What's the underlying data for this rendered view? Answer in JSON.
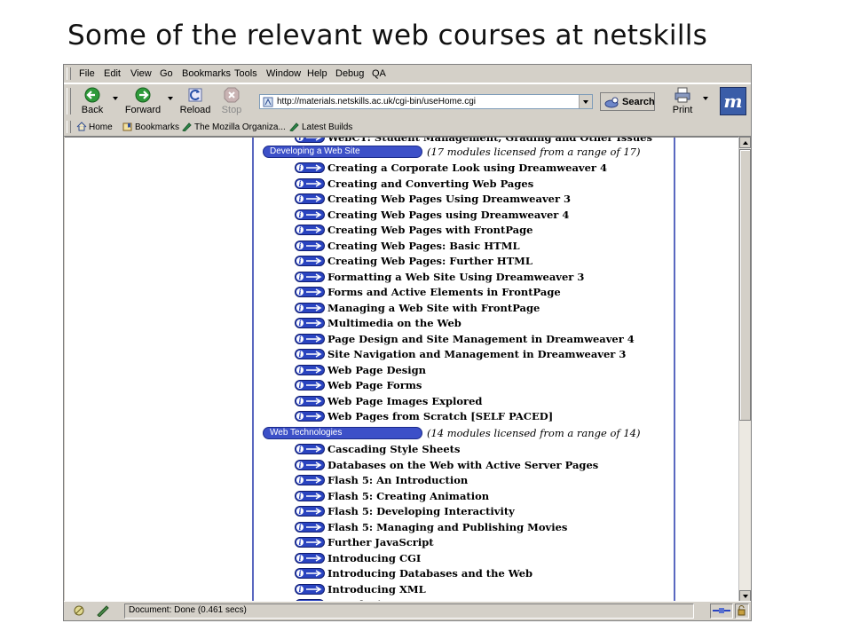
{
  "slide": {
    "title": "Some of the relevant web courses at netskills"
  },
  "menubar": {
    "items": [
      "File",
      "Edit",
      "View",
      "Go",
      "Bookmarks",
      "Tools",
      "Window",
      "Help",
      "Debug",
      "QA"
    ]
  },
  "navbar": {
    "back": "Back",
    "forward": "Forward",
    "reload": "Reload",
    "stop": "Stop",
    "url": "http://materials.netskills.ac.uk/cgi-bin/useHome.cgi",
    "search": "Search",
    "print": "Print",
    "brand_letter": "m"
  },
  "personal_toolbar": {
    "items": [
      "Home",
      "Bookmarks",
      "The Mozilla Organiza...",
      "Latest Builds"
    ]
  },
  "content": {
    "top_partial": "WebCT: Student Management, Grading and Other Issues",
    "categories": [
      {
        "name": "Developing a Web Site",
        "note": "(17 modules licensed from a range of 17)",
        "courses": [
          "Creating a Corporate Look using Dreamweaver 4",
          "Creating and Converting Web Pages",
          "Creating Web Pages Using Dreamweaver 3",
          "Creating Web Pages using Dreamweaver 4",
          "Creating Web Pages with FrontPage",
          "Creating Web Pages: Basic HTML",
          "Creating Web Pages: Further HTML",
          "Formatting a Web Site Using Dreamweaver 3",
          "Forms and Active Elements in FrontPage",
          "Managing a Web Site with FrontPage",
          "Multimedia on the Web",
          "Page Design and Site Management in Dreamweaver 4",
          "Site Navigation and Management in Dreamweaver 3",
          "Web Page Design",
          "Web Page Forms",
          "Web Page Images Explored",
          "Web Pages from Scratch [SELF PACED]"
        ]
      },
      {
        "name": "Web Technologies",
        "note": "(14 modules licensed from a range of 14)",
        "courses": [
          "Cascading Style Sheets",
          "Databases on the Web with Active Server Pages",
          "Flash 5: An Introduction",
          "Flash 5: Creating Animation",
          "Flash 5: Developing Interactivity",
          "Flash 5: Managing and Publishing Movies",
          "Further JavaScript",
          "Introducing CGI",
          "Introducing Databases and the Web",
          "Introducing XML",
          "Introducing XSL"
        ]
      }
    ]
  },
  "statusbar": {
    "text": "Document: Done (0.461 secs)"
  },
  "colors": {
    "category_bar": "#3c50c8",
    "frame_line": "#5a68c0",
    "window_chrome": "#d4d0c8"
  }
}
